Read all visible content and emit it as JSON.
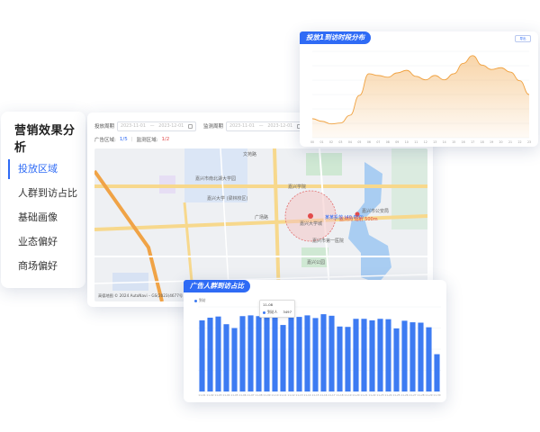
{
  "sidebar": {
    "title": "营销效果分析",
    "items": [
      {
        "label": "投放区域",
        "active": true
      },
      {
        "label": "人群到访占比",
        "active": false
      },
      {
        "label": "基础画像",
        "active": false
      },
      {
        "label": "业态偏好",
        "active": false
      },
      {
        "label": "商场偏好",
        "active": false
      }
    ]
  },
  "map_panel": {
    "filters": [
      {
        "label": "投放周期",
        "start": "2023-11-01",
        "sep": "—",
        "end": "2023-12-01"
      },
      {
        "label": "监测周期",
        "start": "2023-11-01",
        "sep": "—",
        "end": "2023-12-01"
      }
    ],
    "ad_area_label": "广告区域:",
    "ad_area_value": "1/5",
    "separator": "|",
    "monitor_area_label": "监测区域:",
    "monitor_area_value": "1/2",
    "places": {
      "school": "嘉兴学院",
      "university": "嘉兴市南北湖大学园",
      "campus": "嘉兴大学\n(梁林校区)",
      "landmark": "嘉兴大学城",
      "ad_label": "某某投放\n(40,000)",
      "monitor_label": "监测周\n辐射 500m",
      "police": "嘉兴市公安局",
      "hospital": "嘉兴市第一医院",
      "park": "嘉兴公园",
      "wenyuan": "文苑路",
      "guangcha": "广场路"
    },
    "copyright": "高德地图  © 2024 AutoNavi – GS(2023)4677号"
  },
  "line_panel": {
    "tag": "投放1到访时段分布",
    "button_label": "导出",
    "accent": "#f0a13f"
  },
  "bar_panel": {
    "tag": "广告人群到访占比",
    "legend": "到访",
    "tooltip": {
      "title": "11-08",
      "name": "到访人",
      "value": "3497"
    },
    "accent": "#3d7bf2"
  },
  "chart_data": [
    {
      "type": "area",
      "title": "投放1到访时段分布",
      "x": [
        "00",
        "01",
        "02",
        "03",
        "04",
        "05",
        "06",
        "07",
        "08",
        "09",
        "10",
        "11",
        "12",
        "13",
        "14",
        "15",
        "16",
        "17",
        "18",
        "19",
        "20",
        "21",
        "22",
        "23"
      ],
      "series": [
        {
          "values": [
            22,
            19,
            16,
            17,
            26,
            49,
            74,
            72,
            70,
            75,
            78,
            71,
            67,
            72,
            67,
            74,
            86,
            95,
            84,
            79,
            81,
            76,
            66,
            50
          ]
        }
      ],
      "ylim": [
        0,
        100
      ],
      "yticks": [
        "",
        "",
        "",
        "",
        "",
        "",
        ""
      ],
      "grid": true
    },
    {
      "type": "bar",
      "title": "广告人群到访占比",
      "categories": [
        "11-01",
        "11-02",
        "11-03",
        "11-04",
        "11-05",
        "11-06",
        "11-07",
        "11-08",
        "11-09",
        "11-10",
        "11-11",
        "11-12",
        "11-13",
        "11-14",
        "11-15",
        "11-16",
        "11-17",
        "11-18",
        "11-19",
        "11-20",
        "11-21",
        "11-22",
        "11-23",
        "11-24",
        "11-25",
        "11-26",
        "11-27",
        "11-28",
        "11-29",
        "11-30"
      ],
      "series": [
        {
          "name": "到访",
          "values": [
            3350,
            3420,
            3450,
            3250,
            3150,
            3460,
            3480,
            3460,
            3470,
            3420,
            3230,
            3420,
            3440,
            3480,
            3410,
            3510,
            3470,
            3190,
            3180,
            3390,
            3390,
            3350,
            3390,
            3380,
            3140,
            3340,
            3300,
            3290,
            3170,
            2470
          ]
        }
      ],
      "ylim": [
        1500,
        3700
      ],
      "grid": true,
      "legend": "top-left"
    }
  ]
}
